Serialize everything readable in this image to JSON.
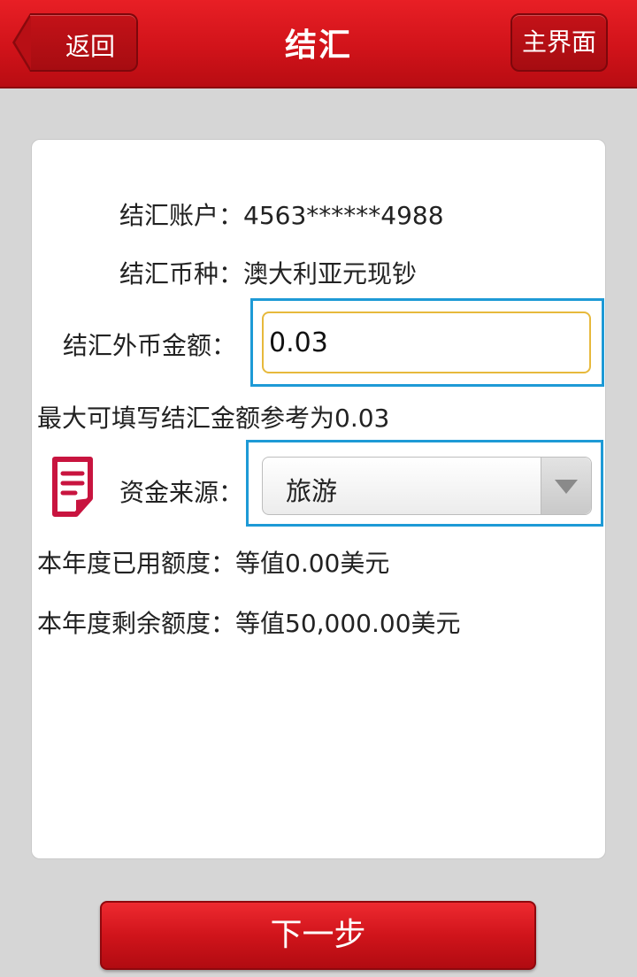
{
  "header": {
    "title": "结汇",
    "back_label": "返回",
    "home_label": "主界面"
  },
  "form": {
    "account_label": "结汇账户：",
    "account_value": "4563******4988",
    "currency_label": "结汇币种：",
    "currency_value": "澳大利亚元现钞",
    "amount_label": "结汇外币金额：",
    "amount_value": "0.03",
    "max_note": "最大可填写结汇金额参考为0.03",
    "source_label": "资金来源：",
    "source_selected": "旅游",
    "used_label": "本年度已用额度：",
    "used_value": "等值0.00美元",
    "remaining_label": "本年度剩余额度：",
    "remaining_value": "等值50,000.00美元"
  },
  "footer": {
    "next_label": "下一步"
  },
  "colors": {
    "brand_red": "#d1131a",
    "highlight_blue": "#1e9ad6",
    "input_focus_border": "#e7b93c"
  },
  "icons": {
    "back": "back-arrow-icon",
    "source": "document-icon",
    "dropdown": "dropdown-arrow-icon"
  }
}
